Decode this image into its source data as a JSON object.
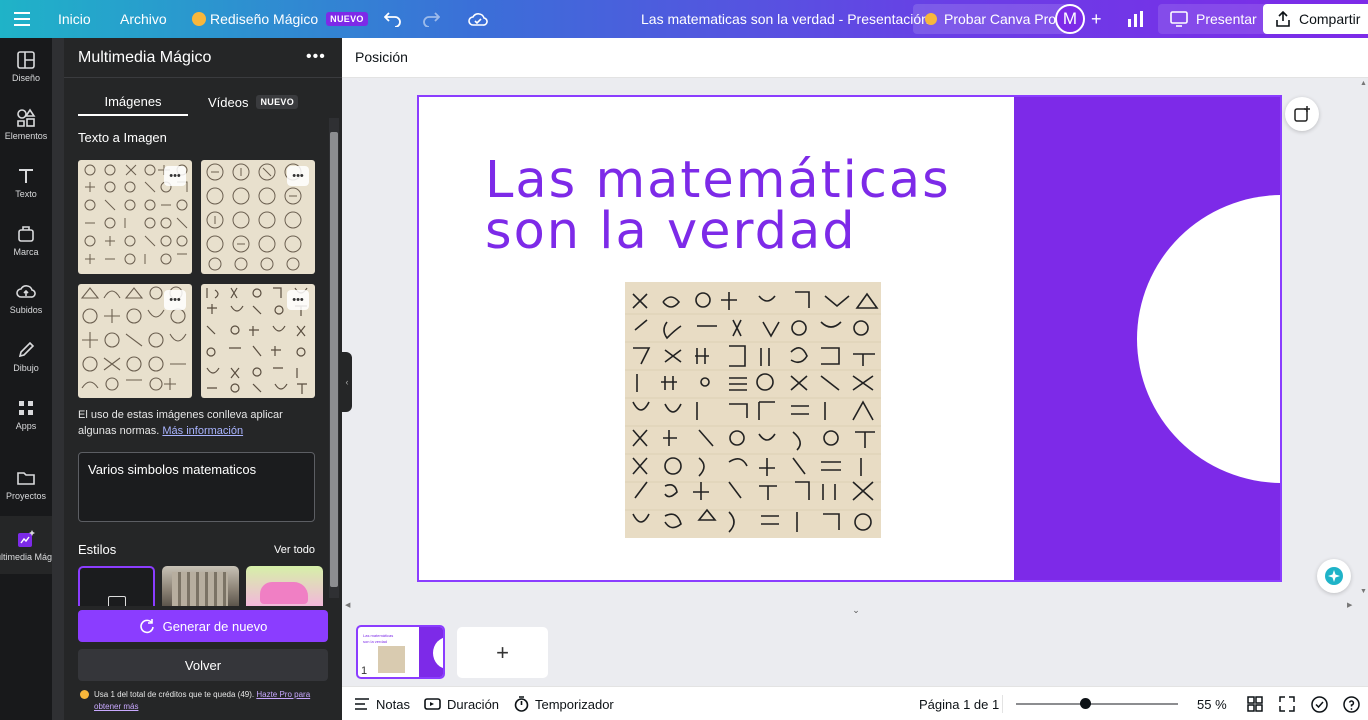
{
  "topbar": {
    "home": "Inicio",
    "file": "Archivo",
    "magic_resize": "Rediseño Mágico",
    "magic_badge": "NUEVO",
    "doc_title": "Las matematicas son la verdad - Presentación",
    "try_pro": "Probar Canva Pro",
    "avatar_letter": "M",
    "present": "Presentar",
    "share": "Compartir"
  },
  "rail": {
    "items": [
      {
        "label": "Diseño",
        "icon": "layout-icon"
      },
      {
        "label": "Elementos",
        "icon": "shapes-icon"
      },
      {
        "label": "Texto",
        "icon": "text-icon"
      },
      {
        "label": "Marca",
        "icon": "brand-icon"
      },
      {
        "label": "Subidos",
        "icon": "upload-icon"
      },
      {
        "label": "Dibujo",
        "icon": "draw-icon"
      },
      {
        "label": "Apps",
        "icon": "apps-icon"
      },
      {
        "label": "Proyectos",
        "icon": "folder-icon"
      },
      {
        "label": "Multimedia Mágico",
        "icon": "magic-media-icon"
      }
    ]
  },
  "panel": {
    "title": "Multimedia Mágico",
    "tab_images": "Imágenes",
    "tab_videos": "Vídeos",
    "tab_videos_badge": "NUEVO",
    "section_text_to_image": "Texto a Imagen",
    "notice": "El uso de estas imágenes conlleva aplicar algunas normas.",
    "notice_link": "Más información",
    "prompt_value": "Varios simbolos matematicos",
    "styles_title": "Estilos",
    "see_all": "Ver todo",
    "generate_again": "Generar de nuevo",
    "back": "Volver",
    "credits_text": "Usa 1 del total de créditos que te queda (49).",
    "credits_link": "Hazte Pro para obtener más"
  },
  "toolbar2": {
    "position": "Posición"
  },
  "slide": {
    "title_line1": "Las matemáticas",
    "title_line2": "son la verdad",
    "accent_color": "#7d2ae8"
  },
  "pages": {
    "page_number": "1",
    "add_icon": "+"
  },
  "bottombar": {
    "notes": "Notas",
    "duration": "Duración",
    "timer": "Temporizador",
    "page_indicator": "Página 1 de 1",
    "zoom": "55 %",
    "zoom_fraction": 0.55
  }
}
